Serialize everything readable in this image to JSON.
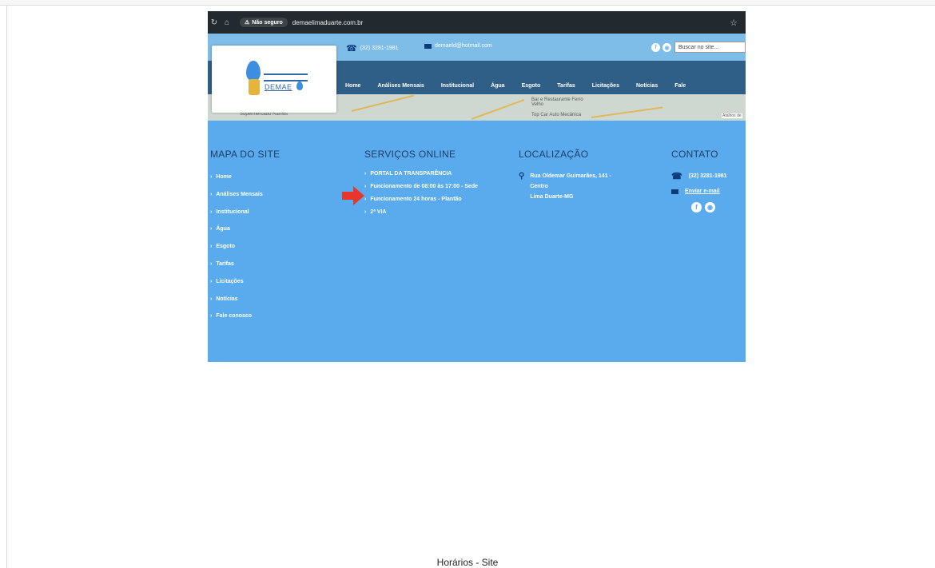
{
  "browser": {
    "security_badge": "Não seguro",
    "url": "demaelimaduarte.com.br"
  },
  "topbar": {
    "phone": "(32) 3281-1981",
    "email": "demaeld@hotmail.com",
    "search_placeholder": "Buscar no site..."
  },
  "logo": {
    "name": "DEMAE"
  },
  "nav": {
    "items": [
      "Home",
      "Análises Mensais",
      "Institucional",
      "Água",
      "Esgoto",
      "Tarifas",
      "Licitações",
      "Notícias",
      "Fale"
    ]
  },
  "map": {
    "labels": [
      "Supermercado Ramos",
      "Bar e Restaurante Ferro Velho",
      "Top Car Auto Mecânica",
      "Atalhos de"
    ]
  },
  "footer": {
    "sitemap": {
      "title": "MAPA DO SITE",
      "items": [
        "Home",
        "Análises Mensais",
        "Institucional",
        "Água",
        "Esgoto",
        "Tarifas",
        "Licitações",
        "Notícias",
        "Fale conosco"
      ]
    },
    "services": {
      "title": "SERVIÇOS ONLINE",
      "items": [
        "PORTAL DA TRANSPARÊNCIA",
        "Funcionamento de 08:00 às 17:00 - Sede",
        "Funcionamento 24 horas - Plantão",
        "2ª VIA"
      ]
    },
    "location": {
      "title": "LOCALIZAÇÃO",
      "line1": "Rua Oldemar Guimarães, 141 -",
      "line2": "Centro",
      "line3": "Lima Duarte-MG"
    },
    "contact": {
      "title": "CONTATO",
      "phone": "(32) 3281-1981",
      "email_link": "Enviar e-mail"
    }
  },
  "caption": "Horários - Site",
  "colors": {
    "footer_bg": "#5aabed",
    "nav_bg": "#2f5e86",
    "heading": "#1e3e66",
    "arrow": "#e8362c"
  }
}
